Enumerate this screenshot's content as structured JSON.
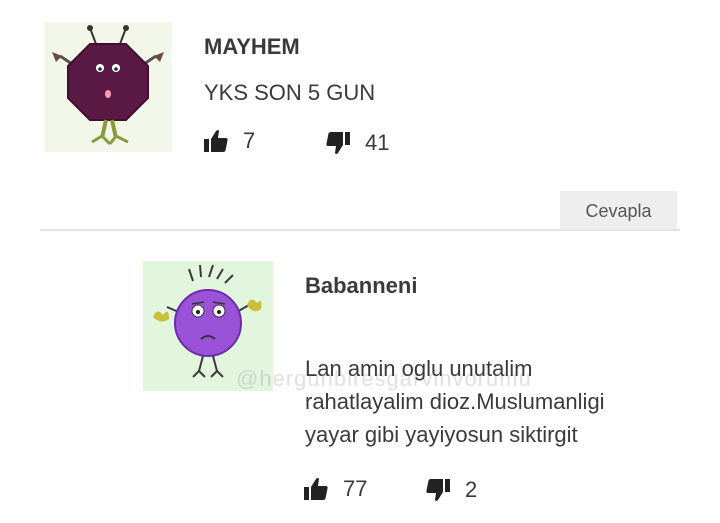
{
  "comments": [
    {
      "username": "MAYHEM",
      "text": "YKS SON 5 GUN",
      "likes": "7",
      "dislikes": "41",
      "avatar_icon": "purple-octagon-monster-avatar"
    }
  ],
  "reply_button_label": "Cevapla",
  "replies": [
    {
      "username": "Babanneni",
      "text_lines": [
        "Lan amin oglu unutalim",
        "rahatlayalim dioz.Muslumanligi",
        "yayar gibi yayiyosun siktirgit"
      ],
      "likes": "77",
      "dislikes": "2",
      "avatar_icon": "purple-round-monster-avatar"
    }
  ],
  "watermark": "@hergunbiresgarvinvorumu",
  "colors": {
    "text": "#3a3a3a",
    "button_bg": "#eeeeee",
    "avatar1_bg": "#f3f7ea",
    "avatar2_bg": "#e2f6de",
    "monster1": "#5a1a45",
    "monster2": "#9a52d8"
  }
}
